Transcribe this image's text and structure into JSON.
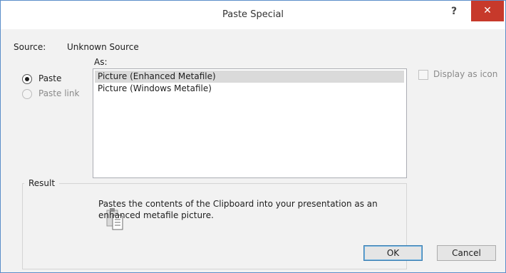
{
  "window": {
    "title": "Paste Special",
    "help_label": "?",
    "close_label": "✕"
  },
  "source": {
    "label": "Source:",
    "value": "Unknown Source"
  },
  "as_label": "As:",
  "options": {
    "paste_label": "Paste",
    "paste_link_label": "Paste link",
    "selected": "Paste"
  },
  "list": {
    "items": [
      "Picture (Enhanced Metafile)",
      "Picture (Windows Metafile)"
    ],
    "selected_index": 0
  },
  "display_as_icon": {
    "label": "Display as icon",
    "checked": false,
    "enabled": false
  },
  "result": {
    "legend": "Result",
    "text": "Pastes the contents of the Clipboard into your presentation as an enhanced metafile picture.",
    "icon": "clipboard-icon"
  },
  "buttons": {
    "ok_label": "OK",
    "cancel_label": "Cancel"
  },
  "colors": {
    "close_button": "#c7392b",
    "window_border": "#5b8ec9",
    "selected_item": "#dadada"
  }
}
